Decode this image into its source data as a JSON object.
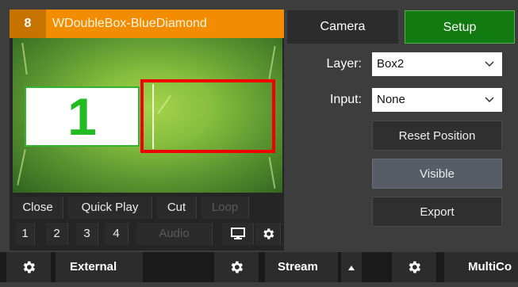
{
  "input": {
    "number": "8",
    "title": "WDoubleBox-BlueDiamond",
    "preview_box_number": "1",
    "controls_row1": [
      "Close",
      "Quick Play",
      "Cut",
      "Loop"
    ],
    "controls_row2": [
      "1",
      "2",
      "3",
      "4",
      "Audio"
    ]
  },
  "tabs": {
    "camera": "Camera",
    "setup": "Setup"
  },
  "setup": {
    "layer_label": "Layer:",
    "layer_value": "Box2",
    "input_label": "Input:",
    "input_value": "None",
    "reset_position": "Reset Position",
    "visible": "Visible",
    "export": "Export"
  },
  "toolbar": {
    "external": "External",
    "stream": "Stream",
    "multicorder": "MultiCo"
  },
  "colors": {
    "title_bar": "#f28c00",
    "setup_tab": "#117a11",
    "selection_box": "#f00000",
    "box_number": "#22bb22"
  },
  "icons": [
    "gear-icon",
    "monitor-icon",
    "caret-up-icon",
    "chevron-down-icon"
  ]
}
